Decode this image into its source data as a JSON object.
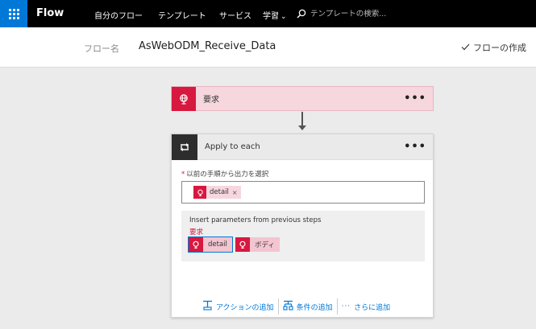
{
  "nav": {
    "brand": "Flow",
    "items": [
      {
        "label": "自分のフロー"
      },
      {
        "label": "テンプレート"
      },
      {
        "label": "サービス"
      },
      {
        "label": "学習"
      }
    ],
    "search_placeholder": "テンプレートの検索..."
  },
  "subheader": {
    "flow_name_label": "フロー名",
    "flow_name_value": "AsWebODM_Receive_Data",
    "create_label": "フローの作成"
  },
  "trigger": {
    "title": "要求",
    "more": "•••",
    "icon": "request-globe-icon"
  },
  "apply_each": {
    "title": "Apply to each",
    "more": "•••",
    "icon": "loop-icon",
    "field_label": "以前の手順から出力を選択",
    "required_marker": "*",
    "selected_token": {
      "label": "detail",
      "remove": "×"
    },
    "dynamic_panel": {
      "title": "Insert parameters from previous steps",
      "group": "要求",
      "chips": [
        {
          "label": "detail"
        },
        {
          "label": "ボディ"
        }
      ]
    },
    "actions": [
      {
        "label": "アクションの追加",
        "icon": "add-action-icon"
      },
      {
        "label": "条件の追加",
        "icon": "add-condition-icon"
      },
      {
        "label": "さらに追加",
        "icon": "more-dots-icon"
      }
    ]
  },
  "colors": {
    "accent": "#0078d7",
    "request_red": "#d7183f",
    "token_pink": "#f6d7de"
  }
}
